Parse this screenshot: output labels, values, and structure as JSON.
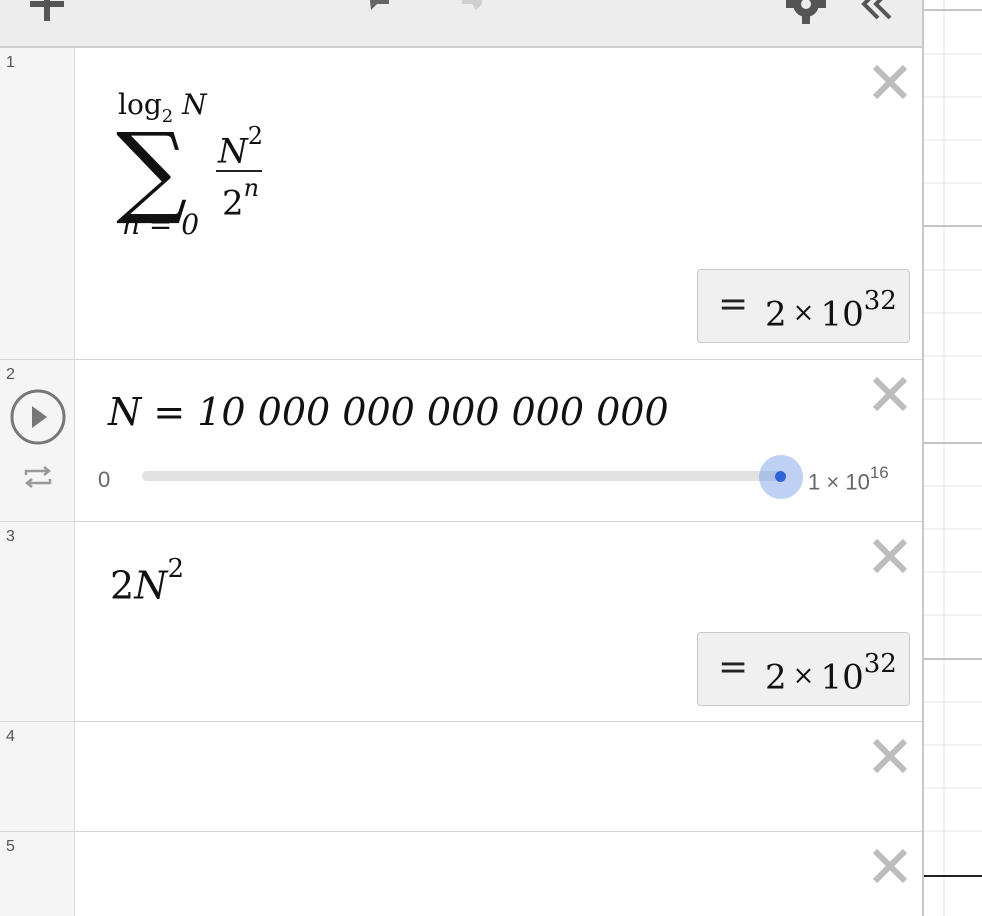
{
  "toolbar": {
    "add_icon": "plus-icon",
    "undo_icon": "undo-icon",
    "redo_icon": "redo-icon",
    "settings_icon": "gear-icon",
    "collapse_icon": "double-chevron-left-icon"
  },
  "expressions": [
    {
      "number": "1",
      "upper": "log",
      "upper_sub": "2",
      "upper_var": "N",
      "lower": "n = 0",
      "numerator": "N",
      "numerator_exp": "2",
      "denominator": "2",
      "denominator_exp": "n",
      "result": {
        "equals": "=",
        "mantissa": "2",
        "times": "×",
        "base": "10",
        "exponent": "32"
      }
    },
    {
      "number": "2",
      "expression": "N = 10 000 000 000 000 000",
      "slider": {
        "min": "0",
        "max_mantissa": "1",
        "max_times": "×",
        "max_base": "10",
        "max_exponent": "16",
        "value_fraction": 1.0
      }
    },
    {
      "number": "3",
      "coefficient": "2",
      "variable": "N",
      "exponent": "2",
      "result": {
        "equals": "=",
        "mantissa": "2",
        "times": "×",
        "base": "10",
        "exponent": "32"
      }
    },
    {
      "number": "4"
    },
    {
      "number": "5"
    }
  ],
  "colors": {
    "accent": "#2f63d6",
    "halo": "#a6bff0"
  }
}
